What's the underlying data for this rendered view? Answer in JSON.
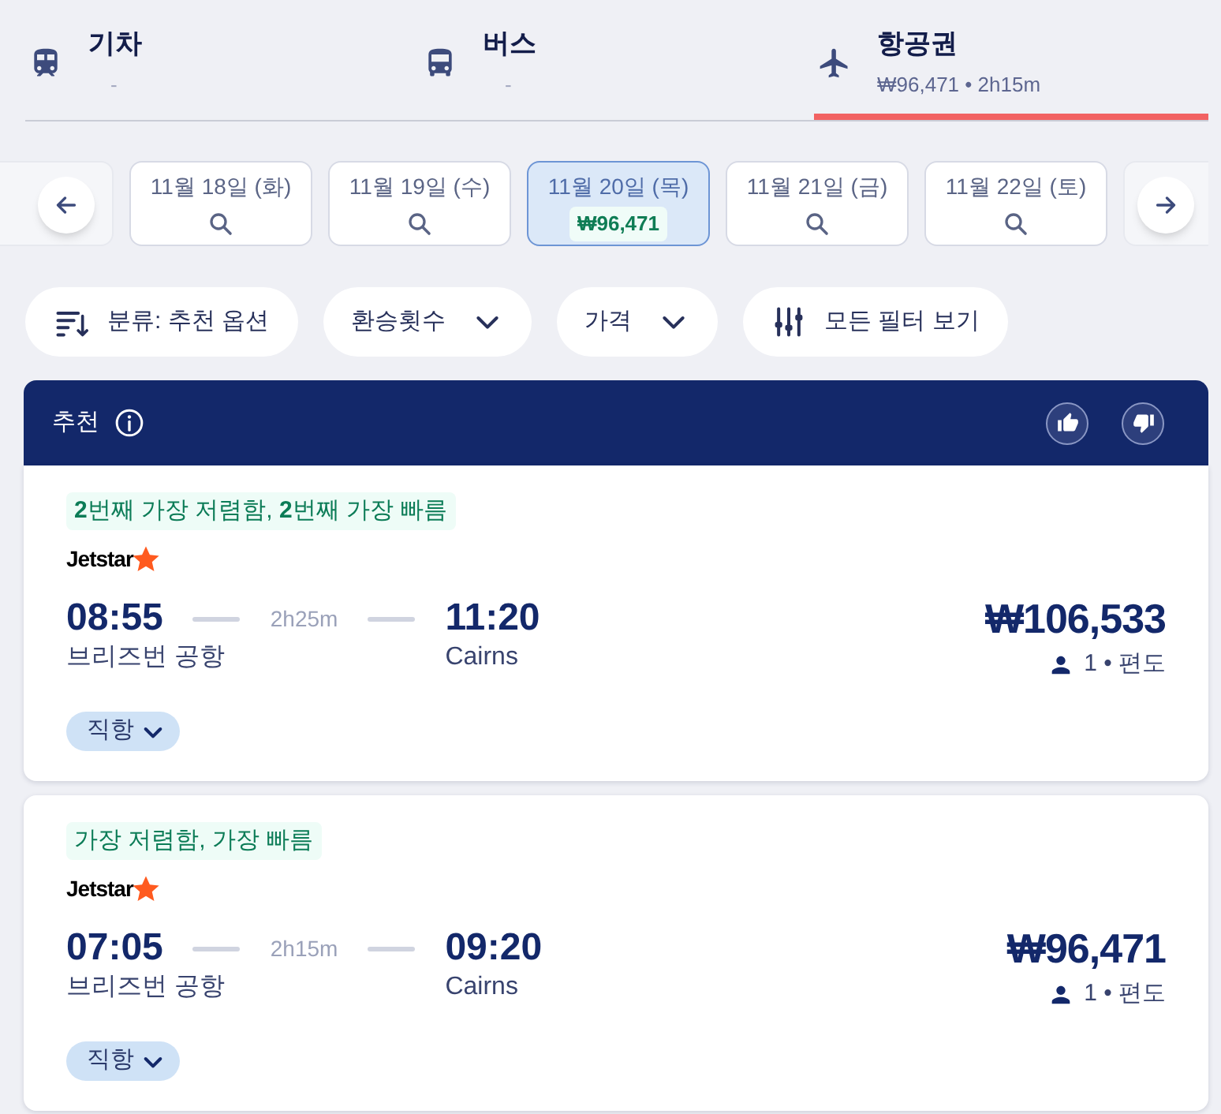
{
  "transport_tabs": [
    {
      "kind": "train",
      "label": "기차",
      "subtitle": "-",
      "selected": false
    },
    {
      "kind": "bus",
      "label": "버스",
      "subtitle": "-",
      "selected": false
    },
    {
      "kind": "plane",
      "label": "항공권",
      "subtitle": "₩96,471 • 2h15m",
      "selected": true
    }
  ],
  "dates": [
    {
      "label": "11월 18일 (화)",
      "selected": false
    },
    {
      "label": "11월 19일 (수)",
      "selected": false
    },
    {
      "label": "11월 20일 (목)",
      "price": "₩96,471",
      "selected": true
    },
    {
      "label": "11월 21일 (금)",
      "selected": false
    },
    {
      "label": "11월 22일 (토)",
      "selected": false
    }
  ],
  "filters": [
    {
      "kind": "sort",
      "label": "분류: 추천 옵션"
    },
    {
      "kind": "dropdown",
      "label": "환승횟수"
    },
    {
      "kind": "dropdown",
      "label": "가격"
    },
    {
      "kind": "all_filters",
      "label": "모든 필터 보기"
    }
  ],
  "recommended": {
    "title": "추천",
    "flights": [
      {
        "tag": "**2**번째 가장 저렴함, **2**번째 가장 빠름",
        "airline": "Jetstar",
        "depart_time": "08:55",
        "duration": "2h25m",
        "arrive_time": "11:20",
        "origin": "브리즈번 공항",
        "destination": "Cairns",
        "price": "₩106,533",
        "trip": "1 • 편도",
        "stops": "직항"
      }
    ]
  },
  "flights": [
    {
      "tag": "가장 저렴함, 가장 빠름",
      "airline": "Jetstar",
      "depart_time": "07:05",
      "duration": "2h15m",
      "arrive_time": "09:20",
      "origin": "브리즈번 공항",
      "destination": "Cairns",
      "price": "₩96,471",
      "trip": "1 • 편도",
      "stops": "직항"
    }
  ]
}
